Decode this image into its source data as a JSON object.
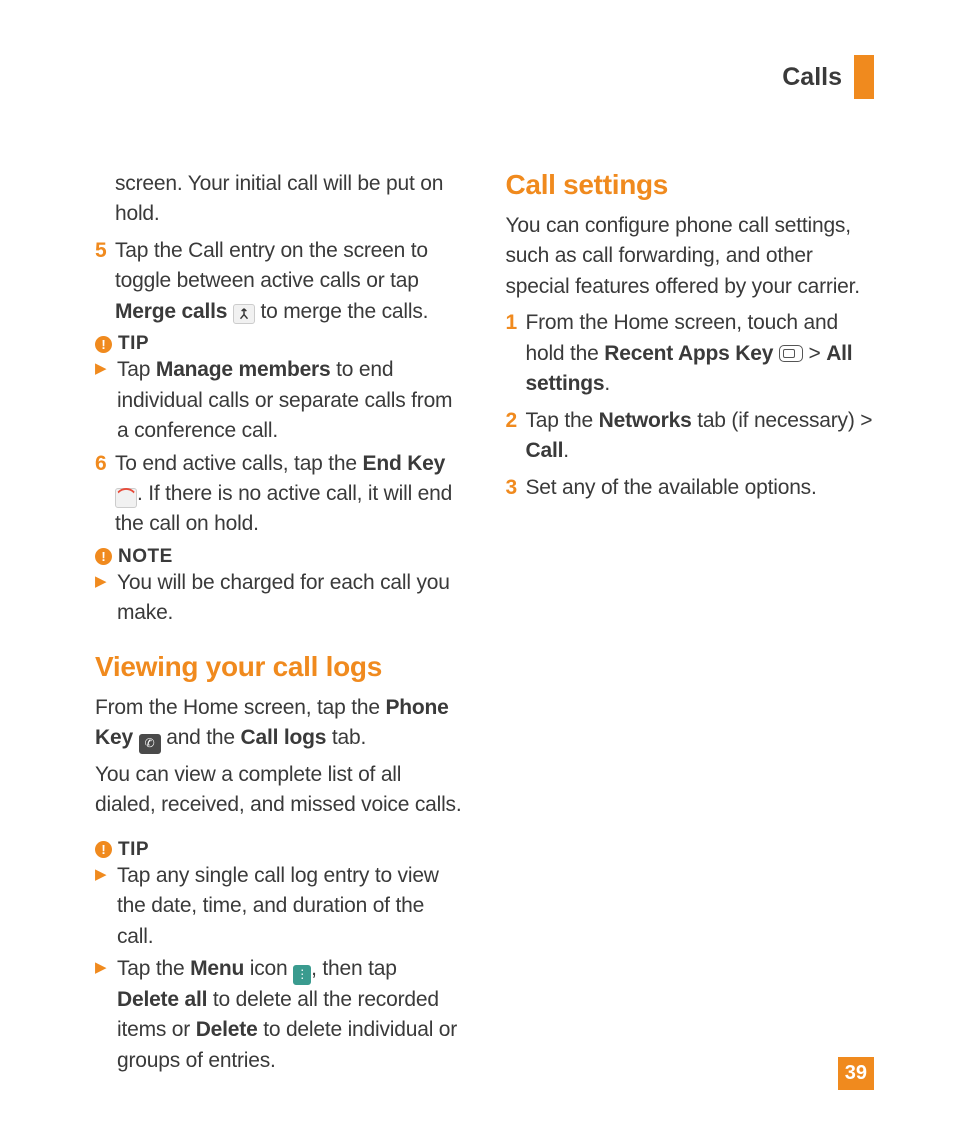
{
  "header": {
    "title": "Calls"
  },
  "pageNumber": "39",
  "left": {
    "continuation": "screen. Your initial call will be put on hold.",
    "step5": {
      "num": "5",
      "pre": "Tap the Call entry on the screen to toggle between active calls or tap ",
      "bold": "Merge calls",
      "post": " to merge the calls."
    },
    "tip1": {
      "label": "TIP",
      "pre": "Tap ",
      "bold": "Manage members",
      "post": " to end individual calls or separate calls from a conference call."
    },
    "step6": {
      "num": "6",
      "pre": "To end active calls, tap the ",
      "bold": "End Key",
      "post": ". If there is no active call, it will end the call on hold."
    },
    "note": {
      "label": "NOTE",
      "text": "You will be charged for each call you make."
    },
    "viewing": {
      "title": "Viewing your call logs",
      "p1_pre": "From the Home screen, tap the ",
      "p1_b1": "Phone Key",
      "p1_mid": " and the ",
      "p1_b2": "Call logs",
      "p1_post": " tab.",
      "p2": "You can view a complete list of all dialed, received, and missed voice calls."
    },
    "tip2": {
      "label": "TIP",
      "b1": "Tap any single call log entry to view the date, time, and duration of the call.",
      "b2_pre": "Tap the ",
      "b2_b1": "Menu",
      "b2_mid1": " icon ",
      "b2_mid2": ", then tap ",
      "b2_b2": "Delete all",
      "b2_mid3": " to delete all the recorded items or ",
      "b2_b3": "Delete",
      "b2_post": " to delete individual or groups of entries."
    }
  },
  "right": {
    "title": "Call settings",
    "p1": "You can configure phone call settings, such as call forwarding,  and other special features offered by your carrier.",
    "s1": {
      "num": "1",
      "pre": "From the Home screen, touch and hold the ",
      "b1": "Recent Apps Key",
      "mid": " > ",
      "b2": "All settings",
      "post": "."
    },
    "s2": {
      "num": "2",
      "pre": "Tap the ",
      "b1": "Networks",
      "mid": " tab (if necessary) > ",
      "b2": "Call",
      "post": "."
    },
    "s3": {
      "num": "3",
      "text": "Set any of the available options."
    }
  }
}
